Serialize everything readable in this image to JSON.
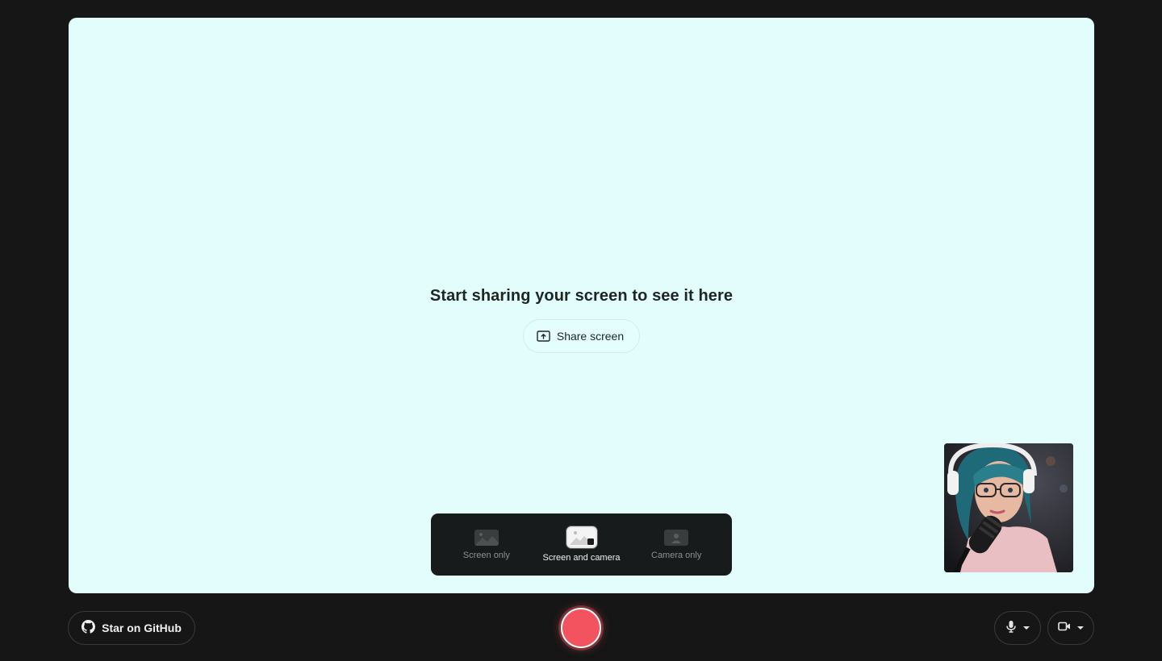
{
  "stage": {
    "title": "Start sharing your screen to see it here",
    "share_button_label": "Share screen",
    "share_icon": "screen-share-icon",
    "background": "#e2fdfc"
  },
  "mode_switcher": {
    "selected": "Screen and camera",
    "modes": [
      {
        "label": "Screen only",
        "icon": "screen-only-icon",
        "selected": false
      },
      {
        "label": "Screen and camera",
        "icon": "screen-and-camera-icon",
        "selected": true
      },
      {
        "label": "Camera only",
        "icon": "camera-only-icon",
        "selected": false
      }
    ]
  },
  "camera_preview": {
    "icon": "camera-preview-image"
  },
  "footer": {
    "github_label": "Star on GitHub",
    "github_icon": "github-icon",
    "record_icon": "record-button",
    "mic_icon": "microphone-icon",
    "video_icon": "video-camera-icon",
    "record_color": "#f2535e"
  }
}
